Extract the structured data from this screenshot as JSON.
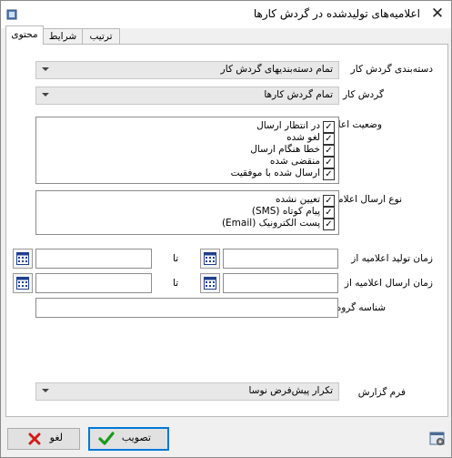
{
  "window": {
    "title": "اعلامیه‌های تولیدشده در گردش کارها",
    "close_glyph": "✕"
  },
  "tabs": [
    {
      "label": "محتوی",
      "active": true
    },
    {
      "label": "شرایط",
      "active": false
    },
    {
      "label": "ترتیب",
      "active": false
    }
  ],
  "fields": {
    "workflow_category": {
      "label": "دسته‌بندی گردش کار",
      "value": "تمام دسته‌بندیهای گردش کار"
    },
    "workflow": {
      "label": "گردش کار",
      "value": "تمام گردش کارها"
    },
    "status": {
      "label": "وضعیت اعلامیه",
      "items": [
        {
          "label": "در انتظار ارسال",
          "checked": true
        },
        {
          "label": "لغو شده",
          "checked": true
        },
        {
          "label": "خطا هنگام ارسال",
          "checked": true
        },
        {
          "label": "منقضی شده",
          "checked": true
        },
        {
          "label": "ارسال شده با موفقیت",
          "checked": true
        }
      ]
    },
    "send_type": {
      "label": "نوع ارسال اعلامیه",
      "items": [
        {
          "label": "تعیین نشده",
          "checked": true
        },
        {
          "label": "پیام کوتاه (SMS)",
          "checked": true
        },
        {
          "label": "پست الکترونیک (Email)",
          "checked": true
        }
      ]
    },
    "creation_time": {
      "label": "زمان تولید اعلامیه از",
      "to_label": "تا",
      "from_value": "",
      "to_value": ""
    },
    "send_time": {
      "label": "زمان ارسال اعلامیه از",
      "to_label": "تا",
      "from_value": "",
      "to_value": ""
    },
    "group_id": {
      "label": "شناسه گروه",
      "value": ""
    },
    "report_form": {
      "label": "فرم گزارش",
      "value": "تکرار پیش‌فرض نوسا"
    }
  },
  "buttons": {
    "ok_label": "تصویب",
    "cancel_label": "لغو"
  },
  "icons": {
    "calendar": "calendar-icon",
    "ok": "checkmark-icon",
    "cancel": "x-icon",
    "settings": "settings-icon",
    "app": "app-icon"
  },
  "colors": {
    "ok_check": "#1a9a1a",
    "cancel_x": "#d21a1a",
    "default_button_border": "#0078d7"
  }
}
